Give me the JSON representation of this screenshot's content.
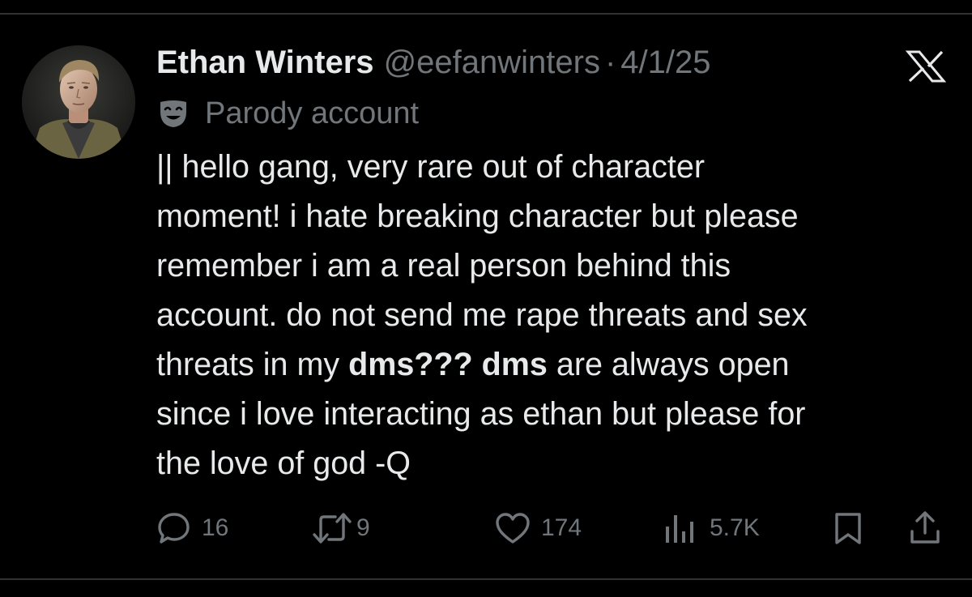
{
  "tweet": {
    "display_name": "Ethan Winters",
    "handle": "@eefanwinters",
    "separator": "·",
    "date": "4/1/25",
    "badge_label": "Parody account",
    "text_lines": [
      [
        "|| hello gang, very rare out of character"
      ],
      [
        "moment! i hate breaking character but please"
      ],
      [
        "remember i am a real person behind this"
      ],
      [
        "account. do not send me rape threats and sex"
      ],
      [
        "threats in my ",
        "dms???",
        " ",
        "dms",
        " are always open"
      ],
      [
        "since i love interacting as ethan but please for"
      ],
      [
        "the love of god -Q"
      ]
    ],
    "bold_words": [
      "dms???",
      "dms"
    ]
  },
  "actions": {
    "replies": "16",
    "reposts": "9",
    "likes": "174",
    "views": "5.7K"
  },
  "icons": {
    "avatar": "avatar-photo",
    "badge": "parody-mask-icon",
    "logo": "x-logo-icon",
    "reply": "reply-icon",
    "repost": "repost-icon",
    "like": "heart-icon",
    "views": "views-icon",
    "bookmark": "bookmark-icon",
    "share": "share-icon"
  },
  "colors": {
    "background": "#000000",
    "text_primary": "#e7e9ea",
    "text_secondary": "#71767b",
    "divider": "#2f3336"
  }
}
